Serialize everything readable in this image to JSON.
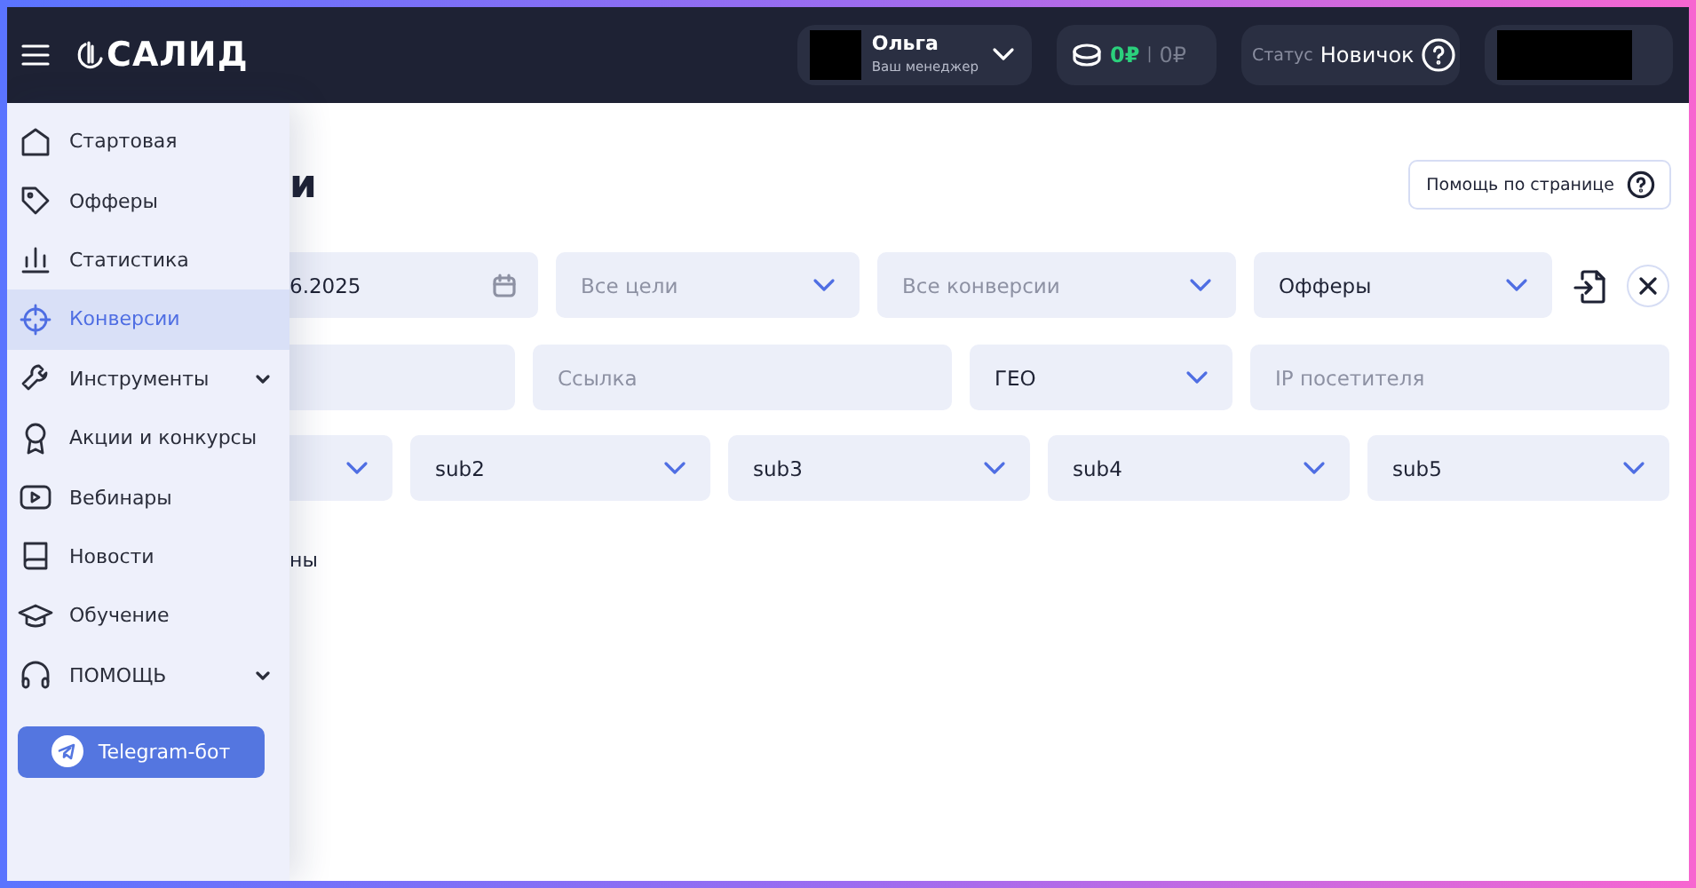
{
  "header": {
    "logo": "САЛИД",
    "manager": {
      "name": "Ольга",
      "role": "Ваш менеджер"
    },
    "balance": {
      "main": "0₽",
      "separator": "|",
      "hold": "0₽"
    },
    "status": {
      "label": "Статус",
      "value": "Новичок"
    }
  },
  "sidebar": {
    "items": [
      {
        "label": "Стартовая",
        "kind": "link",
        "selected": false
      },
      {
        "label": "Офферы",
        "kind": "link",
        "selected": false
      },
      {
        "label": "Статистика",
        "kind": "link",
        "selected": false
      },
      {
        "label": "Конверсии",
        "kind": "link",
        "selected": true
      },
      {
        "label": "Инструменты",
        "kind": "group",
        "selected": false,
        "expanded": false
      },
      {
        "label": "Акции и конкурсы",
        "kind": "link",
        "selected": false
      },
      {
        "label": "Вебинары",
        "kind": "link",
        "selected": false
      },
      {
        "label": "Новости",
        "kind": "link",
        "selected": false
      },
      {
        "label": "Обучение",
        "kind": "link",
        "selected": false
      },
      {
        "label": "ПОМОЩЬ",
        "kind": "group",
        "selected": false,
        "expanded": false
      }
    ],
    "telegram_button": "Telegram-бот"
  },
  "page": {
    "title": "и",
    "help_button": "Помощь по странице",
    "filters": [
      [
        {
          "kind": "date",
          "value": "6.2025"
        },
        {
          "kind": "select",
          "placeholder": "Все цели"
        },
        {
          "kind": "select",
          "placeholder": "Все конверсии"
        },
        {
          "kind": "select",
          "value": "Офферы"
        }
      ],
      [
        {
          "kind": "input"
        },
        {
          "kind": "input",
          "placeholder": "Ссылка"
        },
        {
          "kind": "select",
          "value": "ГЕО"
        },
        {
          "kind": "input",
          "placeholder": "IP посетителя"
        }
      ],
      [
        {
          "kind": "select"
        },
        {
          "kind": "select",
          "value": "sub2"
        },
        {
          "kind": "select",
          "value": "sub3"
        },
        {
          "kind": "select",
          "value": "sub4"
        },
        {
          "kind": "select",
          "value": "sub5"
        }
      ]
    ],
    "note": "ны"
  }
}
